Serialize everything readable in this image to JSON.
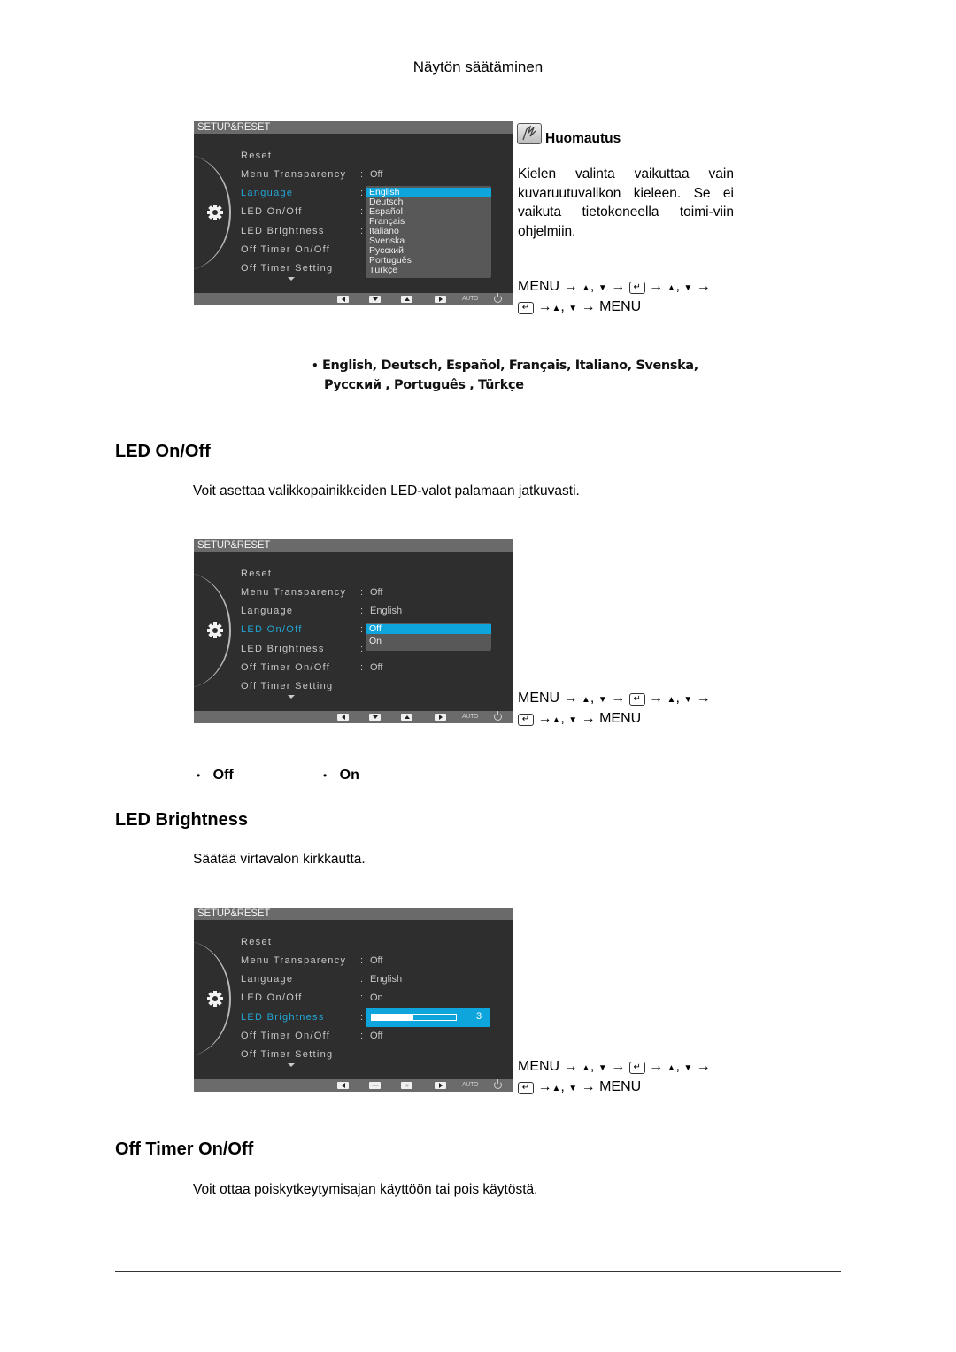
{
  "header": {
    "title": "Näytön säätäminen"
  },
  "osd_common": {
    "title": "SETUP&RESET",
    "menu_items": [
      "Reset",
      "Menu Transparency",
      "Language",
      "LED On/Off",
      "LED Brightness",
      "Off Timer On/Off",
      "Off Timer Setting"
    ],
    "auto_label": "AUTO",
    "colors": {
      "highlight": "#0ea5dc",
      "active_text": "#23a6d5",
      "background": "#2e2e2e"
    }
  },
  "language_section": {
    "osd": {
      "active_item": "Language",
      "values": {
        "menu_transparency": "Off"
      },
      "dropdown_options": [
        "English",
        "Deutsch",
        "Español",
        "Français",
        "Italiano",
        "Svenska",
        "Русский",
        "Português",
        "Türkçe"
      ],
      "selected": "English",
      "buttons": [
        "left",
        "down",
        "up",
        "enter",
        "auto",
        "power"
      ]
    },
    "note": {
      "title": "Huomautus",
      "text": "Kielen valinta vaikuttaa vain kuvaruutuvalikon kieleen. Se ei vaikuta tietokoneella toimi-viin ohjelmiin."
    },
    "nav": {
      "menu": "MENU",
      "arrow": "→",
      "up": "▲",
      "down": "▼",
      "comma": ",",
      "enter": "↵"
    },
    "languages_line1": "English, Deutsch, Español, Français,  Italiano, Svenska,",
    "languages_line2": "Русский , Português , Türkçe",
    "bullet": "•"
  },
  "led_onoff_section": {
    "heading": "LED On/Off",
    "description": "Voit asettaa valikkopainikkeiden LED-valot palamaan jatkuvasti.",
    "osd": {
      "active_item": "LED On/Off",
      "values": {
        "menu_transparency": "Off",
        "language": "English",
        "off_timer_onoff": "Off"
      },
      "dropdown_options": [
        "Off",
        "On"
      ],
      "selected": "Off"
    },
    "options": [
      "Off",
      "On"
    ]
  },
  "led_brightness_section": {
    "heading": "LED Brightness",
    "description": "Säätää virtavalon kirkkautta.",
    "osd": {
      "active_item": "LED Brightness",
      "values": {
        "menu_transparency": "Off",
        "language": "English",
        "led_onoff": "On",
        "off_timer_onoff": "Off"
      },
      "slider_value": "3",
      "slider_fraction": 0.49,
      "buttons": [
        "left",
        "minus",
        "plus",
        "enter",
        "auto",
        "power"
      ]
    }
  },
  "off_timer_section": {
    "heading": "Off Timer On/Off",
    "description": "Voit ottaa poiskytkeytymisajan käyttöön tai pois käytöstä."
  }
}
